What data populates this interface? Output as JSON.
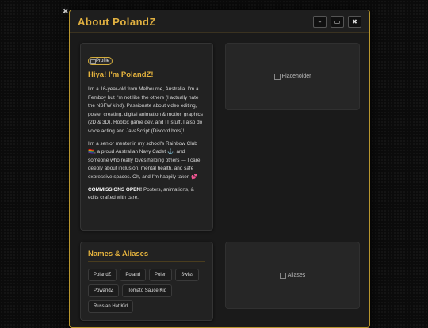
{
  "window": {
    "title": "About PolandZ",
    "controls": {
      "minimize": "–",
      "maximize": "▭",
      "close": "✖"
    }
  },
  "intro": {
    "badge": "Profile",
    "greeting": "Hiya! I'm PolandZ!",
    "para1": "I'm a 16-year-old from Melbourne, Australia. I'm a Femboy but I'm not like the others (I actually hate the NSFW kind). Passionate about video editing, poster creating, digital animation & motion graphics (2D & 3D), Roblox game dev, and IT stuff. I also do voice acting and JavaScript (Discord bots)!",
    "para2": "I'm a senior mentor in my school's Rainbow Club 🏳️‍🌈, a proud Australian Navy Cadet ⚓, and someone who really loves helping others — I care deeply about inclusion, mental health, and safe expressive spaces. Oh, and I'm happily taken 💕",
    "commissions_label": "COMMISSIONS OPEN!",
    "commissions_text": " Posters, animations, & edits crafted with care."
  },
  "images": {
    "placeholder_alt": "Placeholder",
    "aliases_alt": "Aliases"
  },
  "aliases": {
    "title": "Names & Aliases",
    "items": [
      "PolandZ",
      "Poland",
      "Polen",
      "Swiss",
      "PowandZ",
      "Tomato Sauce Kid",
      "Russian Hat Kid"
    ]
  }
}
